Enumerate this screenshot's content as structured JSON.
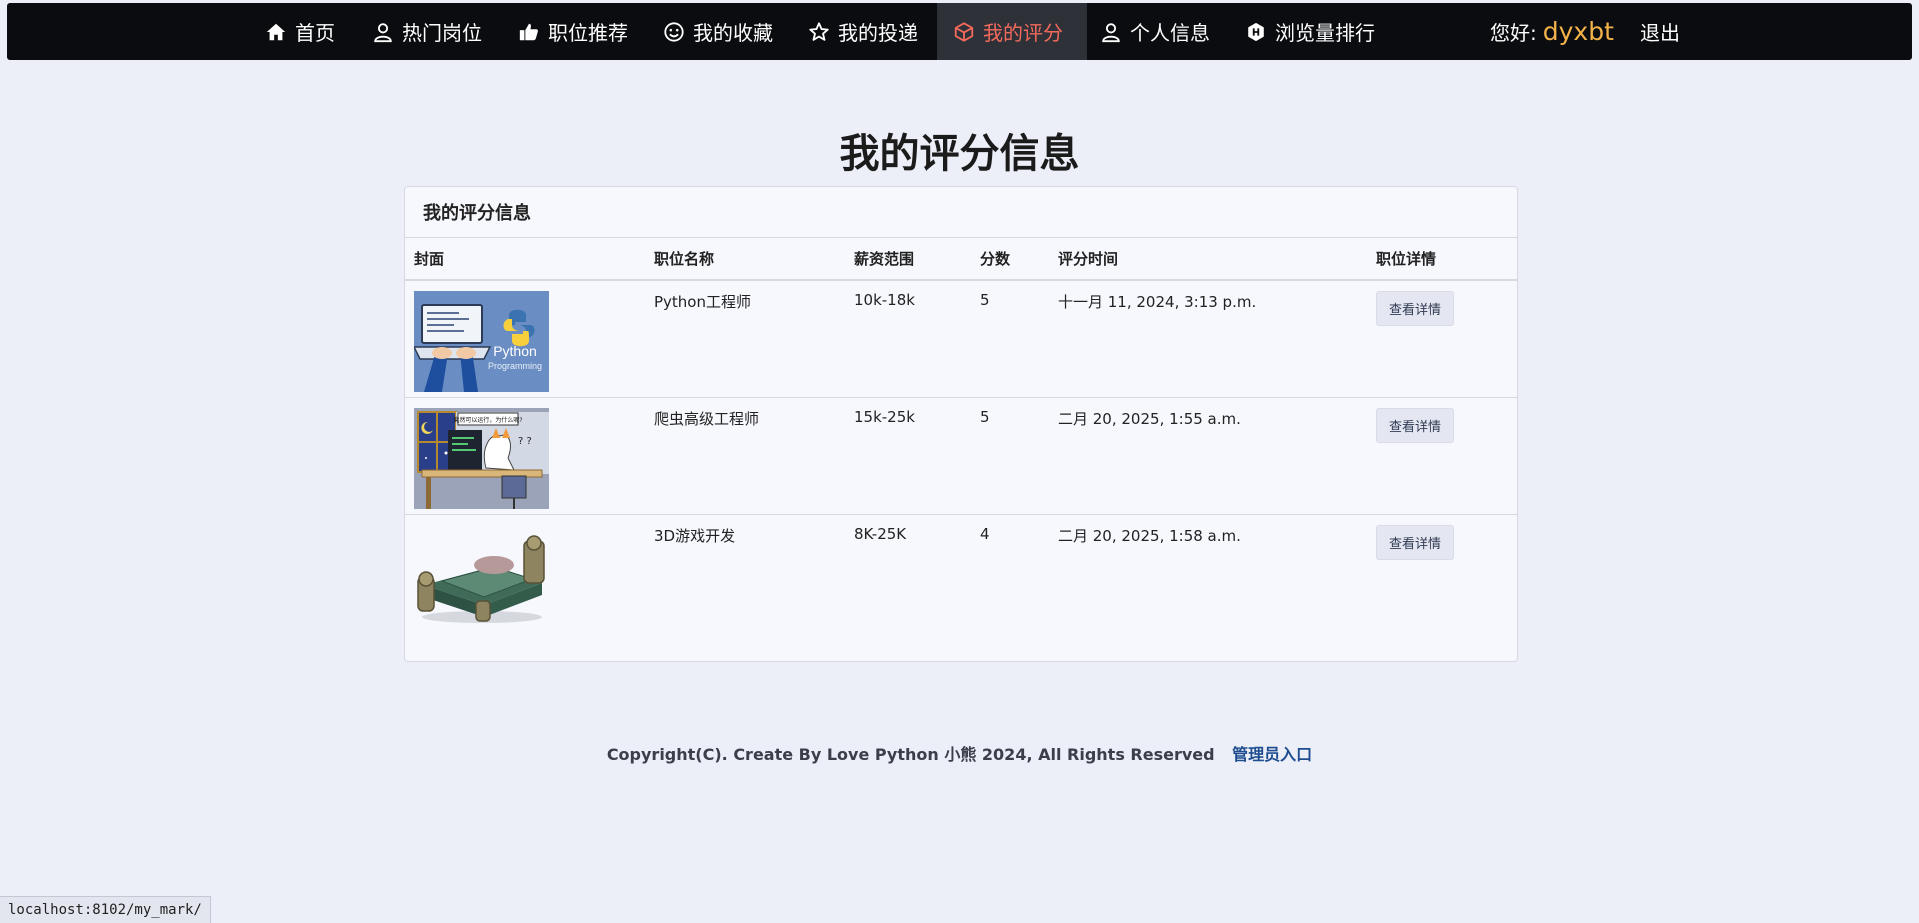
{
  "nav": {
    "items": [
      {
        "label": "首页",
        "icon": "home-icon"
      },
      {
        "label": "热门岗位",
        "icon": "user-icon"
      },
      {
        "label": "职位推荐",
        "icon": "thumbs-up-icon"
      },
      {
        "label": "我的收藏",
        "icon": "smile-icon"
      },
      {
        "label": "我的投递",
        "icon": "star-icon"
      },
      {
        "label": "我的评分",
        "icon": "cube-icon",
        "active": true
      },
      {
        "label": "个人信息",
        "icon": "user-icon"
      },
      {
        "label": "浏览量排行",
        "icon": "hexagon-icon"
      }
    ],
    "greeting": "您好:",
    "username": "dyxbt",
    "logout": "退出"
  },
  "page_title": "我的评分信息",
  "card": {
    "header": "我的评分信息",
    "columns": [
      "封面",
      "职位名称",
      "薪资范围",
      "分数",
      "评分时间",
      "职位详情"
    ],
    "rows": [
      {
        "title": "Python工程师",
        "salary": "10k-18k",
        "score": "5",
        "time": "十一月 11, 2024, 3:13 p.m.",
        "button": "查看详情",
        "cover_text": "Python",
        "cover_sub": "Programming"
      },
      {
        "title": "爬虫高级工程师",
        "salary": "15k-25k",
        "score": "5",
        "time": "二月 20, 2025, 1:55 a.m.",
        "button": "查看详情",
        "cover_text": "竟然可以运行，为什么呢?"
      },
      {
        "title": "3D游戏开发",
        "salary": "8K-25K",
        "score": "4",
        "time": "二月 20, 2025, 1:58 a.m.",
        "button": "查看详情"
      }
    ]
  },
  "footer": {
    "copyright": "Copyright(C). Create By Love Python 小熊 2024, All Rights Reserved",
    "admin": "管理员入口"
  },
  "status_url": "localhost:8102/my_mark/",
  "colors": {
    "nav_bg": "#0b0c0f",
    "active": "#f46a5c",
    "username": "#f4b24a",
    "page_bg": "#eceef8",
    "admin_link": "#1d4d8f"
  }
}
